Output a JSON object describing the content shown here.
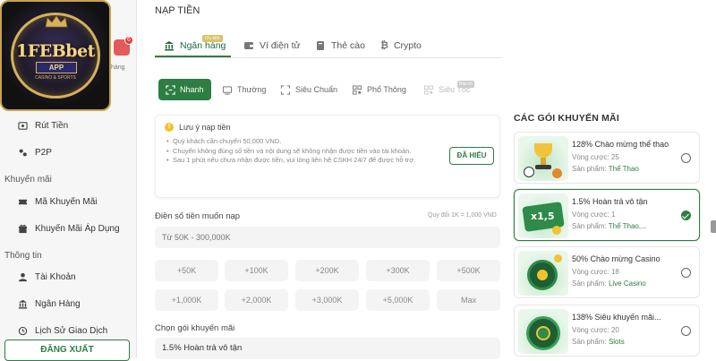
{
  "brand": {
    "logo_text": "1FEBbet",
    "logo_ribbon": "APP",
    "logo_sub": "CASINO & SPORTS",
    "mini_label": "hàng",
    "mini_badge": "6"
  },
  "sidebar": {
    "items_top": [
      {
        "label": "Rút Tiền",
        "icon": "withdraw-icon"
      },
      {
        "label": "P2P",
        "icon": "p2p-icon"
      }
    ],
    "group_promo": "Khuyến mãi",
    "items_promo": [
      {
        "label": "Mã Khuyến Mãi",
        "icon": "ticket-icon"
      },
      {
        "label": "Khuyến Mãi Áp Dụng",
        "icon": "gift-icon"
      }
    ],
    "group_info": "Thông tin",
    "items_info": [
      {
        "label": "Tài Khoản",
        "icon": "user-icon"
      },
      {
        "label": "Ngân Hàng",
        "icon": "bank-icon"
      },
      {
        "label": "Lịch Sử Giao Dịch",
        "icon": "history-icon"
      }
    ],
    "logout": "ĐĂNG XUẤT"
  },
  "page": {
    "title": "NẠP TIỀN"
  },
  "tabs": [
    {
      "label": "Ngân hàng",
      "icon": "bank-icon",
      "active": true,
      "badge": "Ưu tiên"
    },
    {
      "label": "Ví điện tử",
      "icon": "wallet-icon",
      "active": false
    },
    {
      "label": "Thẻ cào",
      "icon": "card-icon",
      "active": false
    },
    {
      "label": "Crypto",
      "icon": "bitcoin-icon",
      "active": false
    }
  ],
  "methods": [
    {
      "label": "Nhanh",
      "icon": "scan-icon",
      "active": true
    },
    {
      "label": "Thường",
      "icon": "transfer-icon",
      "active": false
    },
    {
      "label": "Siêu Chuẩn",
      "icon": "frame-icon",
      "active": false
    },
    {
      "label": "Phổ Thông",
      "icon": "qr-icon",
      "active": false
    },
    {
      "label": "Siêu Tốc",
      "icon": "qr-icon",
      "active": false,
      "disabled": true,
      "badge": "Bảo trì"
    }
  ],
  "notice": {
    "title": "Lưu ý nạp tiền",
    "lines": [
      "Quý khách cần chuyển 50,000 VND.",
      "Chuyển không đúng số tiền và nội dung sẽ không nhận được tiền vào tài khoản.",
      "Sau 1 phút nếu chưa nhận được tiền, vui lòng liên hệ CSKH 24/7 để được hỗ trợ."
    ],
    "button": "ĐÃ HIỂU"
  },
  "amount": {
    "label": "Điền số tiền muốn nạp",
    "rate": "Quy đổi 1K = 1,000 VND",
    "placeholder": "Từ 50K - 300,000K",
    "quick": [
      "+50K",
      "+100K",
      "+200K",
      "+300K",
      "+500K",
      "+1,000K",
      "+2,000K",
      "+3,000K",
      "+5,000K",
      "Max"
    ]
  },
  "promo": {
    "label": "Chọn gói khuyến mãi",
    "selected": "1.5% Hoàn trả vô tận"
  },
  "packages": {
    "title": "CÁC GÓI KHUYẾN MÃI",
    "bet_label": "Vòng cược:",
    "product_label": "Sản phẩm:",
    "items": [
      {
        "name": "128% Chào mừng thể thao",
        "bet": "25",
        "product": "Thể Thao",
        "selected": false
      },
      {
        "name": "1.5% Hoàn trả vô tận",
        "bet": "1",
        "product": "Thể Thao,...",
        "selected": true,
        "art_text": "x1,5"
      },
      {
        "name": "50% Chào mừng Casino",
        "bet": "18",
        "product": "Live Casino",
        "selected": false
      },
      {
        "name": "138% Siêu khuyến mãi...",
        "bet": "20",
        "product": "Slots",
        "selected": false
      }
    ]
  }
}
